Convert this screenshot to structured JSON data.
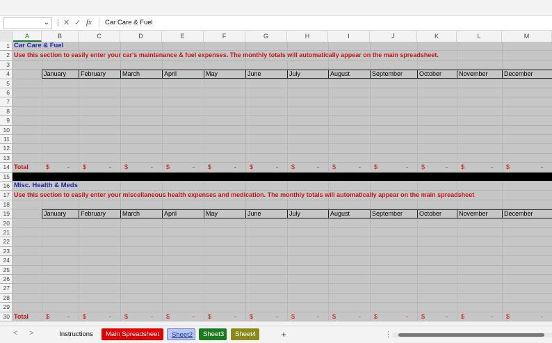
{
  "formula_bar": {
    "name_box": "",
    "cancel_icon": "✕",
    "enter_icon": "✓",
    "fx_label": "fx",
    "content": "Car Care & Fuel"
  },
  "columns": [
    "A",
    "B",
    "C",
    "D",
    "E",
    "F",
    "G",
    "H",
    "I",
    "J",
    "K",
    "L",
    "M"
  ],
  "rows": [
    "1",
    "2",
    "3",
    "4",
    "5",
    "6",
    "7",
    "8",
    "9",
    "10",
    "11",
    "12",
    "13",
    "14",
    "15",
    "16",
    "17",
    "18",
    "19",
    "20",
    "21",
    "22",
    "23",
    "24",
    "25",
    "26",
    "27",
    "28",
    "29",
    "30"
  ],
  "months": [
    "January",
    "February",
    "March",
    "April",
    "May",
    "June",
    "July",
    "August",
    "September",
    "October",
    "November",
    "December"
  ],
  "section1": {
    "title": "Car Care & Fuel",
    "instruction": "Use this section to easily enter your car's maintenance & fuel expenses. The monthly totals will automatically appear on the main spreadsheet.",
    "total_label": "Total"
  },
  "section2": {
    "title": "Misc. Health & Meds",
    "instruction": "Use this section to easily enter your miscellaneous health expenses and medication. The monthly totals will automatically appear on the main spreadsheet",
    "total_label": "Total"
  },
  "total_currency": "$",
  "total_value": "-",
  "tabs": [
    {
      "label": "Instructions",
      "bg": "#f3f3f3",
      "fg": "#000000"
    },
    {
      "label": "Main Spreadsheet",
      "bg": "#e00000",
      "fg": "#ffffff"
    },
    {
      "label": "Sheet2",
      "bg": "#b8c8f0",
      "fg": "#1a2aa8",
      "active": true
    },
    {
      "label": "Sheet3",
      "bg": "#1e7a1e",
      "fg": "#ffffff"
    },
    {
      "label": "Sheet4",
      "bg": "#8a8a1a",
      "fg": "#ffffff"
    }
  ],
  "add_sheet_label": "+",
  "nav": {
    "prev": "<",
    "next": ">",
    "more": "⋮"
  },
  "colors": {
    "title": "#1a2aa8",
    "instruction": "#c01818",
    "cell_bg": "#c6c6c6",
    "header_bg": "#f3f3f3"
  }
}
